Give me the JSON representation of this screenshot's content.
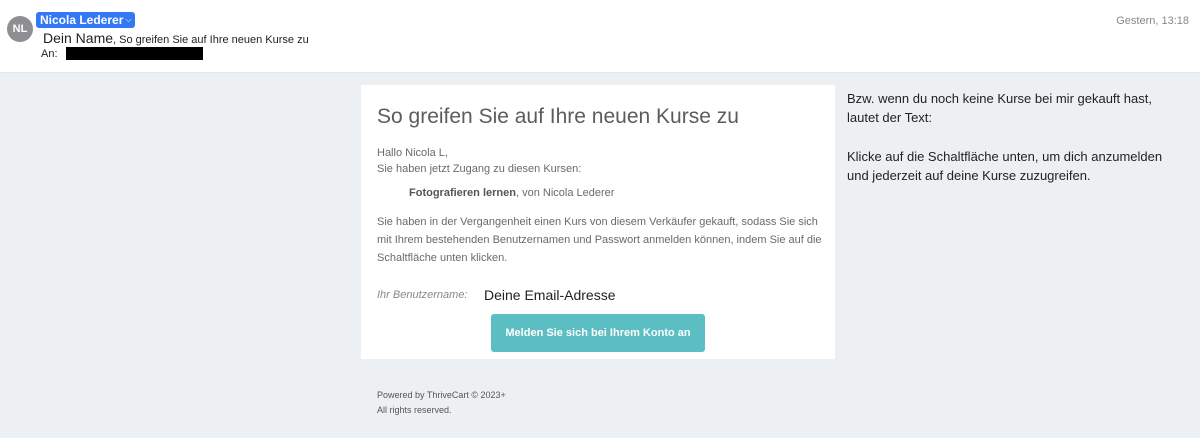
{
  "header": {
    "avatar_initials": "NL",
    "sender_name": "Nicola Lederer",
    "subject_name": "Dein Name",
    "subject_text": ", So greifen Sie auf Ihre neuen Kurse zu",
    "to_label": "An:",
    "date": "Gestern, 13:18"
  },
  "email": {
    "title": "So greifen Sie auf Ihre neuen Kurse zu",
    "greeting": "Hallo Nicola L,",
    "intro": "Sie haben jetzt Zugang zu diesen Kursen:",
    "course_name": "Fotografieren lernen",
    "course_author": ", von Nicola Lederer",
    "paragraph": "Sie haben in der Vergangenheit einen Kurs von diesem Verkäufer gekauft, sodass Sie sich mit Ihrem bestehenden Benutzernamen und Passwort anmelden können, indem Sie auf die Schaltfläche unten klicken.",
    "username_label": "Ihr Benutzername:",
    "username_value": "Deine Email-Adresse",
    "login_button": "Melden Sie sich bei Ihrem Konto an"
  },
  "footer": {
    "powered_by": "Powered by ThriveCart © 2023+",
    "rights": "All rights reserved."
  },
  "side_note": {
    "line1": "Bzw. wenn du noch keine Kurse bei mir gekauft hast, lautet der Text:",
    "line2": "Klicke auf die Schaltfläche unten, um dich anzumelden und jederzeit auf deine Kurse zuzugreifen."
  },
  "colors": {
    "accent": "#3478f6",
    "button": "#5bbec3",
    "background": "#ecf0f2"
  }
}
